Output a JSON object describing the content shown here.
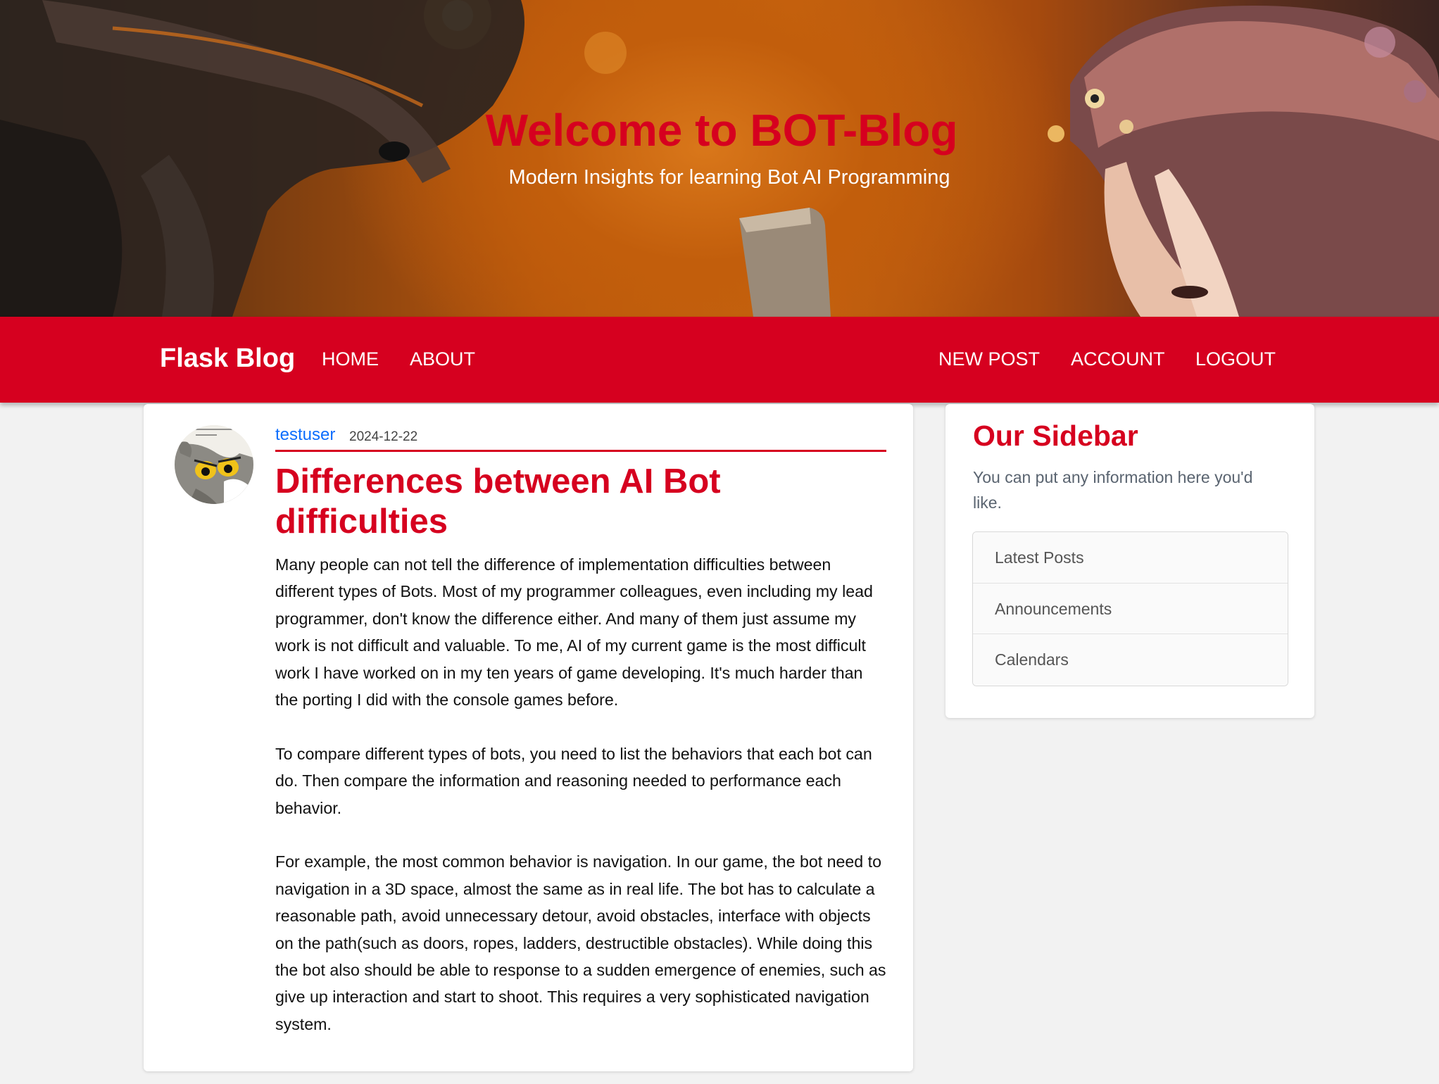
{
  "hero": {
    "title": "Welcome to BOT-Blog",
    "subtitle": "Modern Insights for learning Bot AI Programming"
  },
  "navbar": {
    "brand": "Flask Blog",
    "left_links": [
      "HOME",
      "ABOUT"
    ],
    "right_links": [
      "NEW POST",
      "ACCOUNT",
      "LOGOUT"
    ]
  },
  "post": {
    "author": "testuser",
    "date": "2024-12-22",
    "title": "Differences between AI Bot difficulties",
    "paragraphs": [
      "Many people can not tell the difference of implementation difficulties between different types of Bots. Most of my programmer colleagues, even including my lead programmer, don't know the difference either. And many of them just assume my work is not difficult and valuable. To me, AI of my current game is the most difficult work I have worked on in my ten years of game developing. It's much harder than the porting I did with the console games before.",
      "To compare different types of bots, you need to list the behaviors that each bot can do. Then compare the information and reasoning needed to performance each behavior.",
      "For example, the most common behavior is navigation. In our game, the bot need to navigation in a 3D space, almost the same as in real life. The bot has to calculate a reasonable path, avoid unnecessary detour, avoid obstacles, interface with objects on the path(such as doors, ropes, ladders, destructible obstacles). While doing this the bot also should be able to response to a sudden emergence of enemies, such as give up interaction and start to shoot. This requires a very sophisticated navigation system."
    ]
  },
  "sidebar": {
    "title": "Our Sidebar",
    "description": "You can put any information here you'd like.",
    "items": [
      "Latest Posts",
      "Announcements",
      "Calendars"
    ]
  },
  "colors": {
    "accent": "#d6001f",
    "link": "#0d6efd"
  }
}
